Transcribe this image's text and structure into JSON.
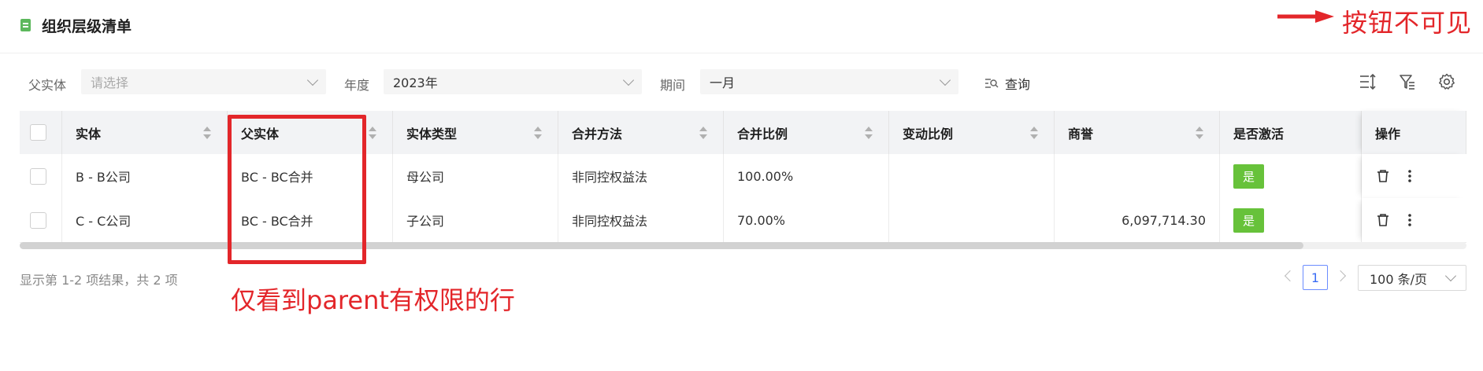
{
  "page": {
    "title": "组织层级清单"
  },
  "annotations": {
    "top_right": "按钮不可见",
    "bottom": "仅看到parent有权限的行"
  },
  "filters": {
    "parent": {
      "label": "父实体",
      "placeholder": "请选择"
    },
    "year": {
      "label": "年度",
      "value": "2023年"
    },
    "period": {
      "label": "期间",
      "value": "一月"
    },
    "query_label": "查询"
  },
  "toolbar": {
    "icons": [
      "column-height-icon",
      "filter-settings-icon",
      "gear-icon"
    ]
  },
  "table": {
    "columns": [
      "实体",
      "父实体",
      "实体类型",
      "合并方法",
      "合并比例",
      "变动比例",
      "商誉",
      "是否激活",
      "操作"
    ],
    "rows": [
      {
        "entity": "B - B公司",
        "parent": "BC - BC合并",
        "type": "母公司",
        "method": "非同控权益法",
        "ratio": "100.00%",
        "change": "",
        "goodwill": "",
        "active": "是"
      },
      {
        "entity": "C - C公司",
        "parent": "BC - BC合并",
        "type": "子公司",
        "method": "非同控权益法",
        "ratio": "70.00%",
        "change": "",
        "goodwill": "6,097,714.30",
        "active": "是"
      }
    ]
  },
  "pagination": {
    "summary": "显示第 1-2 项结果，共 2 项",
    "current_page": "1",
    "page_size": "100 条/页"
  },
  "colors": {
    "accent": "#3a6cf4",
    "active_badge": "#67c23a",
    "annotation": "#e3262a",
    "title_icon": "#5cb85c"
  }
}
